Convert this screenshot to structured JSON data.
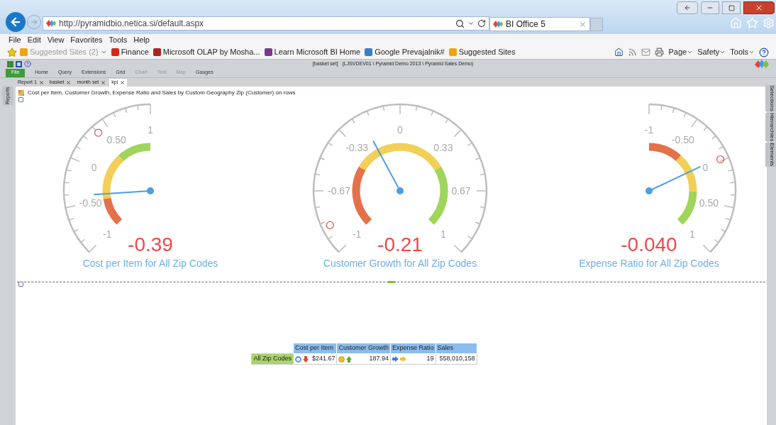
{
  "browser": {
    "url": "http://pyramidbio.netica.si/default.aspx",
    "tab_title": "BI Office 5"
  },
  "menu": [
    "File",
    "Edit",
    "View",
    "Favorites",
    "Tools",
    "Help"
  ],
  "favorites": [
    {
      "label": "Suggested Sites (2)",
      "color": "#f0a30a",
      "disabled": true
    },
    {
      "label": "Finance",
      "color": "#d9261c",
      "disabled": false
    },
    {
      "label": "Microsoft OLAP by Mosha...",
      "color": "#a8261e",
      "disabled": false
    },
    {
      "label": "Learn Microsoft BI  Home",
      "color": "#7a3a8a",
      "disabled": false
    },
    {
      "label": "Google Prevajalnik#",
      "color": "#3b7fc4",
      "disabled": false
    },
    {
      "label": "Suggested Sites",
      "color": "#f0a30a",
      "disabled": false
    }
  ],
  "command_bar": [
    "Page",
    "Safety",
    "Tools"
  ],
  "app": {
    "title": "[basket set]   (LJSVDEV01 \\ Pyramid Demo 2013 \\ Pyramid Sales Demo)"
  },
  "ribbon_tabs": [
    {
      "label": "File",
      "selected": true,
      "disabled": false
    },
    {
      "label": "Home",
      "selected": false,
      "disabled": false
    },
    {
      "label": "Query",
      "selected": false,
      "disabled": false
    },
    {
      "label": "Extensions",
      "selected": false,
      "disabled": false
    },
    {
      "label": "Grid",
      "selected": false,
      "disabled": false
    },
    {
      "label": "Chart",
      "selected": false,
      "disabled": true
    },
    {
      "label": "Text",
      "selected": false,
      "disabled": true
    },
    {
      "label": "Map",
      "selected": false,
      "disabled": true
    },
    {
      "label": "Gauges",
      "selected": false,
      "disabled": false
    }
  ],
  "doc_tabs": [
    {
      "label": "Report 1",
      "selected": false
    },
    {
      "label": "basket",
      "selected": false
    },
    {
      "label": "month set",
      "selected": false
    },
    {
      "label": "kpi",
      "selected": true
    }
  ],
  "side_left": "Reports",
  "side_right": [
    "Selections",
    "Hierarchies",
    "Elements"
  ],
  "caption": "Cost per Item, Customer Growth, Expense Ratio and Sales by Custom Geography Zip (Customer) on rows",
  "gauges": [
    {
      "kind": "left",
      "value": "-0.39",
      "title": "Cost per Item for All Zip Codes",
      "labels": [
        "-1",
        "-0.50",
        "0",
        "0.50",
        "1"
      ]
    },
    {
      "kind": "full",
      "value": "-0.21",
      "title": "Customer Growth for All Zip Codes",
      "labels": [
        "-1",
        "-0.67",
        "-0.33",
        "0",
        "0.33",
        "0.67",
        "1"
      ]
    },
    {
      "kind": "right",
      "value": "-0.040",
      "title": "Expense Ratio for All Zip Codes",
      "labels": [
        "-1",
        "-0.50",
        "0",
        "0.50",
        "1"
      ]
    }
  ],
  "table": {
    "columns": [
      "Cost per Item",
      "Customer Growth",
      "Expense Ratio",
      "Sales"
    ],
    "rows": [
      {
        "label": "All Zip Codes",
        "cells": [
          {
            "value": "$241.67",
            "icons": [
              {
                "kind": "ring",
                "color": "#5b8fd0"
              },
              {
                "kind": "down",
                "color": "#d9462c"
              }
            ]
          },
          {
            "value": "187.94",
            "icons": [
              {
                "kind": "dot",
                "color": "#f2c318"
              },
              {
                "kind": "up",
                "color": "#5aae32"
              }
            ]
          },
          {
            "value": "19",
            "icons": [
              {
                "kind": "right",
                "color": "#3f7fd0"
              },
              {
                "kind": "right",
                "color": "#f2c318"
              }
            ]
          },
          {
            "value": "558,010,158"
          }
        ]
      }
    ]
  }
}
